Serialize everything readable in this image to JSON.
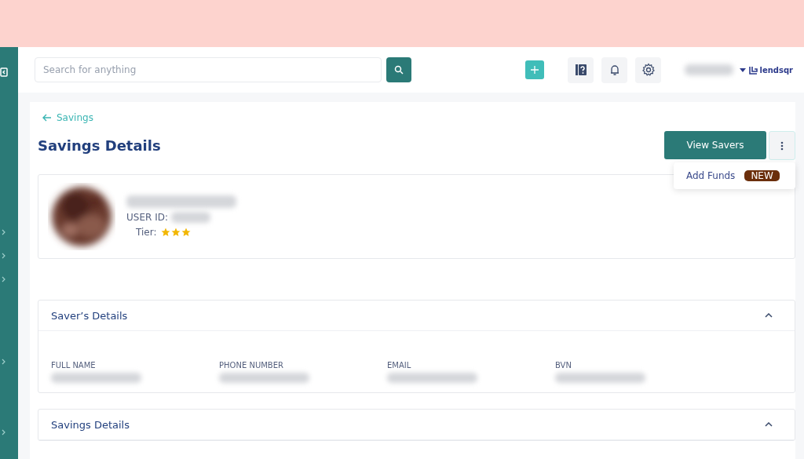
{
  "header": {
    "search": {
      "placeholder": "Search for anything"
    },
    "logo": "lendsqr"
  },
  "breadcrumb": "Savings",
  "page_title": "Savings Details",
  "actions": {
    "primary": "View Savers",
    "menu_open": true,
    "menu_items": [
      {
        "label": "Add Funds",
        "badge": "NEW"
      }
    ]
  },
  "profile": {
    "user_id_label": "USER ID:",
    "tier_label": "Tier:",
    "stars": 3
  },
  "sections": [
    {
      "title": "Saver’s Details",
      "expanded": true,
      "fields": [
        {
          "label": "FULL NAME"
        },
        {
          "label": "PHONE NUMBER"
        },
        {
          "label": "EMAIL"
        },
        {
          "label": "BVN"
        }
      ]
    },
    {
      "title": "Savings Details",
      "expanded": true
    }
  ]
}
